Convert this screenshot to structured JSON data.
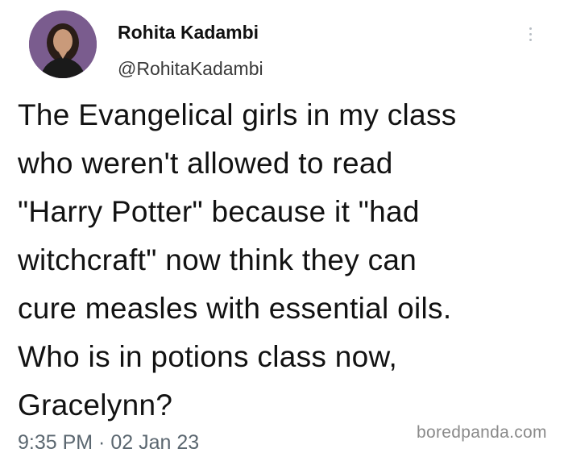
{
  "author": {
    "display_name": "Rohita Kadambi",
    "handle": "@RohitaKadambi"
  },
  "more_icon": "more-vertical-icon",
  "tweet": {
    "text": "The Evangelical girls in my class\nwho weren't allowed to read\n\"Harry Potter\" because it \"had\nwitchcraft\" now think they can\ncure measles with essential oils.\nWho is in potions class now,\nGracelynn?",
    "timestamp": "9:35 PM · 02 Jan 23"
  },
  "watermark": "boredpanda.com",
  "colors": {
    "avatar_bg": "#7a5c8e",
    "text": "#121212",
    "secondary_text": "#5b6770"
  }
}
